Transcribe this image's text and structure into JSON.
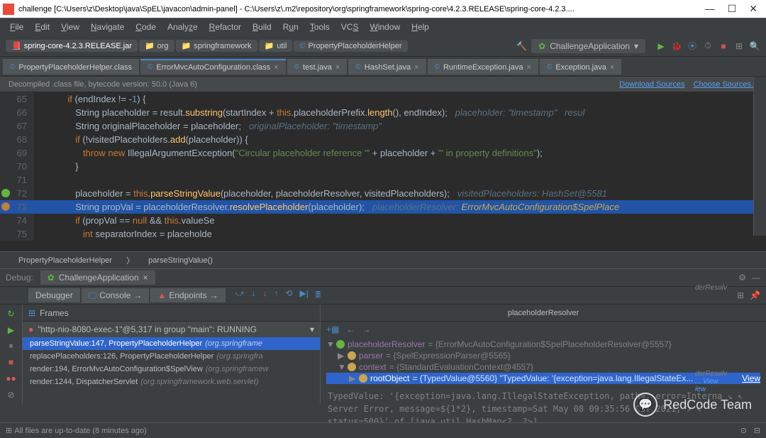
{
  "window": {
    "title": "challenge [C:\\Users\\z\\Desktop\\java\\SpEL\\javacon\\admin-panel] - C:\\Users\\z\\.m2\\repository\\org\\springframework\\spring-core\\4.2.3.RELEASE\\spring-core-4.2.3...."
  },
  "menu": [
    "File",
    "Edit",
    "View",
    "Navigate",
    "Code",
    "Analyze",
    "Refactor",
    "Build",
    "Run",
    "Tools",
    "VCS",
    "Window",
    "Help"
  ],
  "breadcrumb": [
    "spring-core-4.2.3.RELEASE.jar",
    "org",
    "springframework",
    "util",
    "PropertyPlaceholderHelper"
  ],
  "runConfig": "ChallengeApplication",
  "tabs": [
    {
      "label": "PropertyPlaceholderHelper.class",
      "active": false
    },
    {
      "label": "ErrorMvcAutoConfiguration.class",
      "active": true
    },
    {
      "label": "test.java",
      "active": false
    },
    {
      "label": "HashSet.java",
      "active": false
    },
    {
      "label": "RuntimeException.java",
      "active": false
    },
    {
      "label": "Exception.java",
      "active": false
    }
  ],
  "banner": {
    "text": "Decompiled .class file, bytecode version: 50.0 (Java 6)",
    "link1": "Download Sources",
    "link2": "Choose Sources..."
  },
  "code": {
    "lines": [
      {
        "n": "65",
        "html": "            <span class='kw'>if</span> <span class='id'>(endIndex != -</span><span class='num'>1</span><span class='id'>) {</span>"
      },
      {
        "n": "66",
        "html": "               <span class='id'>String placeholder = result.</span><span class='fn'>substring</span><span class='id'>(startIndex + </span><span class='kw'>this</span><span class='id'>.placeholderPrefix.</span><span class='fn'>length</span><span class='id'>(), endIndex);</span>   <span class='cm2'>placeholder: \"timestamp\"   resul</span>"
      },
      {
        "n": "67",
        "html": "               <span class='id'>String originalPlaceholder = placeholder;</span>   <span class='cm2'>originalPlaceholder: \"timestamp\"</span>"
      },
      {
        "n": "68",
        "html": "               <span class='kw'>if</span> <span class='id'>(!visitedPlaceholders.</span><span class='fn'>add</span><span class='id'>(placeholder)) {</span>"
      },
      {
        "n": "69",
        "html": "                  <span class='kw'>throw new</span> <span class='id'>IllegalArgumentException(</span><span class='str'>\"Circular placeholder reference '\"</span> <span class='id'>+ placeholder +</span> <span class='str'>\"' in property definitions\"</span><span class='id'>);</span>"
      },
      {
        "n": "70",
        "html": "               <span class='id'>}</span>"
      },
      {
        "n": "71",
        "html": ""
      },
      {
        "n": "72",
        "bp": "green",
        "html": "               <span class='id'>placeholder = </span><span class='kw'>this</span><span class='id'>.</span><span class='fn'>parseStringValue</span><span class='id'>(placeholder, placeholderResolver, visitedPlaceholders);</span>   <span class='cm2'>visitedPlaceholders: HashSet@5581</span>"
      },
      {
        "n": "73",
        "bp": "orange",
        "hl": true,
        "html": "               <span class='id'>String propVal = placeholderResolver.</span><span class='fn'>resolvePlaceholder</span><span class='id'>(placeholder);</span>   <span class='cm2'>placeholderResolver:</span> <span style='color:#c9a54f;font-style:italic'>ErrorMvcAutoConfiguration$SpelPlace</span>"
      },
      {
        "n": "74",
        "html": "               <span class='kw'>if</span> <span class='id'>(propVal == </span><span class='kw'>null</span> <span class='id'>&amp;&amp; </span><span class='kw'>this</span><span class='id'>.valueSe</span>"
      },
      {
        "n": "75",
        "html": "                  <span class='kw'>int</span> <span class='id'>separatorIndex = placeholde</span>"
      }
    ]
  },
  "crumbBar": [
    "PropertyPlaceholderHelper",
    "parseStringValue()"
  ],
  "debug": {
    "label": "Debug:",
    "tab": "ChallengeApplication",
    "subtabs": [
      "Debugger",
      "Console",
      "Endpoints"
    ],
    "framesLabel": "Frames",
    "thread": "\"http-nio-8080-exec-1\"@5,317 in group \"main\": RUNNING",
    "frames": [
      {
        "m": "parseStringValue:147, PropertyPlaceholderHelper",
        "pkg": "(org.springframe",
        "sel": true
      },
      {
        "m": "replacePlaceholders:126, PropertyPlaceholderHelper",
        "pkg": "(org.springfra"
      },
      {
        "m": "render:194, ErrorMvcAutoConfiguration$SpelView",
        "pkg": "(org.springframew"
      },
      {
        "m": "render:1244, DispatcherServlet",
        "pkg": "(org.springframework.web.servlet)"
      }
    ],
    "varsHeader": "placeholderResolver",
    "vars": {
      "root": {
        "k": "placeholderResolver",
        "v": "= {ErrorMvcAutoConfiguration$SpelPlaceholderResolver@5557}"
      },
      "parser": {
        "k": "parser",
        "v": "= {SpelExpressionParser@5565}"
      },
      "context": {
        "k": "context",
        "v": "= {StandardEvaluationContext@4557}"
      },
      "rootObj": {
        "k": "rootObject",
        "v": "= {TypedValue@5560} \"TypedValue: '{exception=java.lang.IllegalStateEx...",
        "view": "View"
      }
    },
    "tooltip": "TypedValue: '{exception=java.lang.IllegalStateException, path=, error=Interna ↘\n↖ Server Error, message=${1*2}, timestamp=Sat May 08 09:35:56 CST 2021, ↗\n↖ status=500}' of [java.util.HashMap<?, ?>]"
  },
  "statusbar": {
    "text": "All files are up-to-date (8 minutes ago)"
  },
  "rightExtra": [
    "derResolv",
    "derResolv",
    "... View",
    "iew"
  ],
  "watermark": "RedCode Team"
}
